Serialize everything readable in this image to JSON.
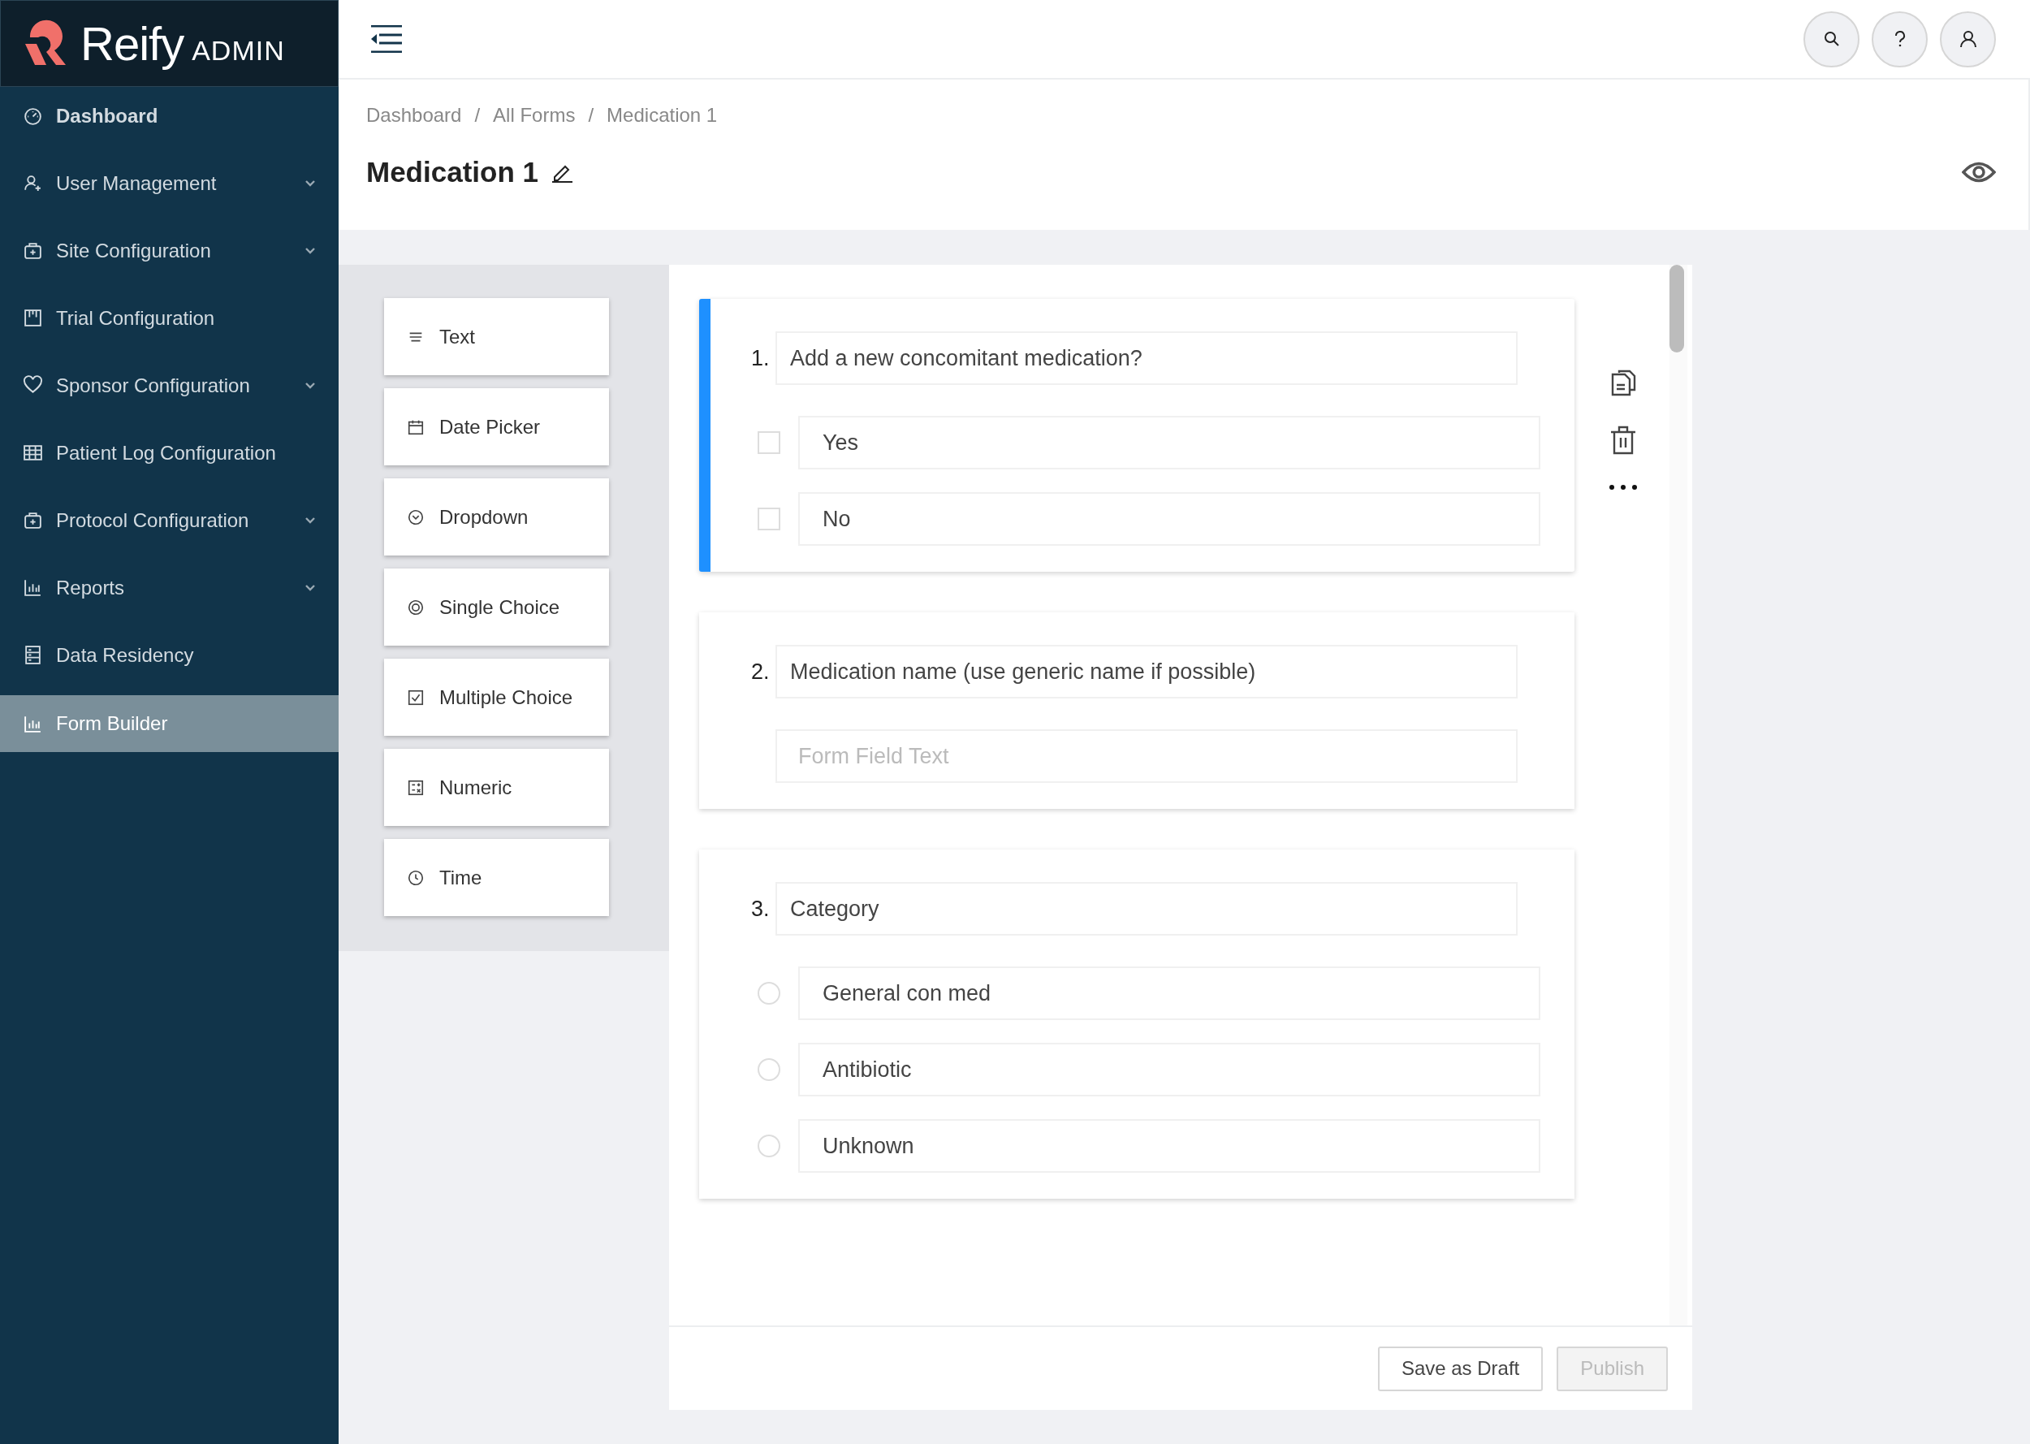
{
  "brand": {
    "name": "Reify",
    "suffix": "ADMIN"
  },
  "sidebar": {
    "items": [
      {
        "label": "Dashboard",
        "expandable": false,
        "selected": false
      },
      {
        "label": "User Management",
        "expandable": true,
        "selected": false
      },
      {
        "label": "Site Configuration",
        "expandable": true,
        "selected": false
      },
      {
        "label": "Trial Configuration",
        "expandable": false,
        "selected": false
      },
      {
        "label": "Sponsor Configuration",
        "expandable": true,
        "selected": false
      },
      {
        "label": "Patient Log Configuration",
        "expandable": false,
        "selected": false
      },
      {
        "label": "Protocol Configuration",
        "expandable": true,
        "selected": false
      },
      {
        "label": "Reports",
        "expandable": true,
        "selected": false
      },
      {
        "label": "Data Residency",
        "expandable": false,
        "selected": false
      },
      {
        "label": "Form Builder",
        "expandable": false,
        "selected": true
      }
    ]
  },
  "breadcrumb": {
    "separator": "/",
    "items": [
      "Dashboard",
      "All Forms",
      "Medication 1"
    ]
  },
  "page_title": "Medication 1",
  "palette": [
    "Text",
    "Date Picker",
    "Dropdown",
    "Single Choice",
    "Multiple Choice",
    "Numeric",
    "Time"
  ],
  "questions": [
    {
      "number": "1.",
      "text": "Add a new concomitant medication?",
      "kind": "checkbox",
      "active": true,
      "options": [
        {
          "label": "Yes",
          "checked": false
        },
        {
          "label": "No",
          "checked": false
        }
      ]
    },
    {
      "number": "2.",
      "text": "Medication name (use generic name if possible)",
      "kind": "text",
      "active": false,
      "placeholder": "Form Field Text"
    },
    {
      "number": "3.",
      "text": "Category",
      "kind": "radio",
      "active": false,
      "options": [
        {
          "label": "General con med",
          "checked": false
        },
        {
          "label": "Antibiotic",
          "checked": false
        },
        {
          "label": "Unknown",
          "checked": false
        }
      ]
    }
  ],
  "footer_buttons": [
    {
      "label": "Save as Draft",
      "disabled": false
    },
    {
      "label": "Publish",
      "disabled": true
    }
  ]
}
